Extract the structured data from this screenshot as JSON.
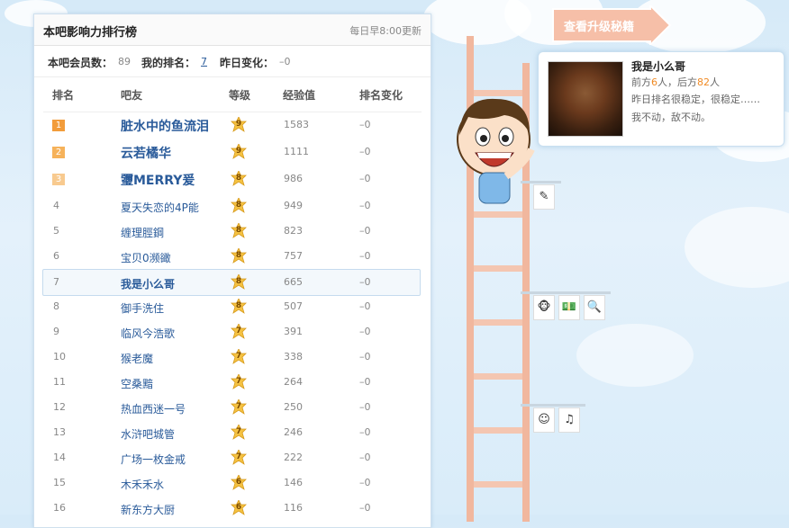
{
  "panel": {
    "title": "本吧影响力排行榜",
    "update_note": "每日早8:00更新",
    "stats": {
      "members_label": "本吧会员数：",
      "members_value": "89",
      "my_rank_label": "我的排名：",
      "my_rank_value": "7",
      "change_label": "昨日变化：",
      "change_value": "–0"
    },
    "columns": [
      "排名",
      "吧友",
      "等级",
      "经验值",
      "排名变化"
    ],
    "rows": [
      {
        "rank": "1",
        "name": "脏水中的鱼流泪",
        "level": "9",
        "xp": "1583",
        "change": "–0"
      },
      {
        "rank": "2",
        "name": "云若橘华",
        "level": "9",
        "xp": "1111",
        "change": "–0"
      },
      {
        "rank": "3",
        "name": "瓕MERRY爰",
        "level": "8",
        "xp": "986",
        "change": "–0"
      },
      {
        "rank": "4",
        "name": "夏天失恋的4P能",
        "level": "8",
        "xp": "949",
        "change": "–0"
      },
      {
        "rank": "5",
        "name": "缠理脛鋼",
        "level": "8",
        "xp": "823",
        "change": "–0"
      },
      {
        "rank": "6",
        "name": "宝贝0濒豃",
        "level": "8",
        "xp": "757",
        "change": "–0"
      },
      {
        "rank": "7",
        "name": "我是小么哥",
        "level": "8",
        "xp": "665",
        "change": "–0"
      },
      {
        "rank": "8",
        "name": "御手洗住",
        "level": "8",
        "xp": "507",
        "change": "–0"
      },
      {
        "rank": "9",
        "name": "临风今浩歌",
        "level": "7",
        "xp": "391",
        "change": "–0"
      },
      {
        "rank": "10",
        "name": "猴老魔",
        "level": "7",
        "xp": "338",
        "change": "–0"
      },
      {
        "rank": "11",
        "name": "空桑黯",
        "level": "7",
        "xp": "264",
        "change": "–0"
      },
      {
        "rank": "12",
        "name": "热血西迷一号",
        "level": "7",
        "xp": "250",
        "change": "–0"
      },
      {
        "rank": "13",
        "name": "水浒吧城管",
        "level": "7",
        "xp": "246",
        "change": "–0"
      },
      {
        "rank": "14",
        "name": "广场一枚金戒",
        "level": "7",
        "xp": "222",
        "change": "–0"
      },
      {
        "rank": "15",
        "name": "木禾禾水",
        "level": "6",
        "xp": "146",
        "change": "–0"
      },
      {
        "rank": "16",
        "name": "新东方大厨",
        "level": "6",
        "xp": "116",
        "change": "–0"
      }
    ]
  },
  "upgrade_button": "查看升级秘籍",
  "profile": {
    "name": "我是小么哥",
    "front_label": "前方",
    "front_count": "6",
    "people": "人",
    "back_label": "，后方",
    "back_count": "82",
    "line2": "昨日排名很稳定，很稳定……",
    "line3": "我不动，敌不动。"
  },
  "colors": {
    "rank1": "#f29c3b",
    "rank2": "#f6b25a",
    "rank3": "#f8ca8f",
    "link": "#2a5b9a",
    "ladder": "#f1b79e"
  }
}
